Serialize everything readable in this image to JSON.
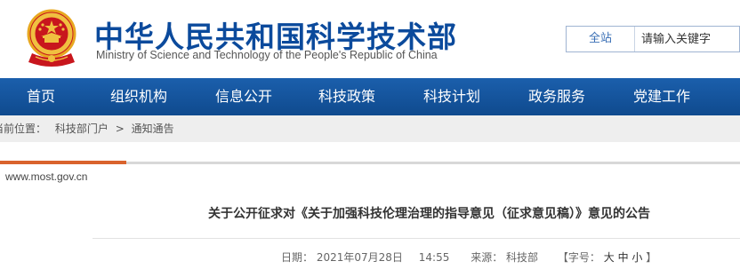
{
  "header": {
    "title_cn": "中华人民共和国科学技术部",
    "title_en": "Ministry of Science and Technology of the People's Republic of China",
    "emblem_icon": "national-emblem-icon",
    "search": {
      "scope": "全站",
      "placeholder": "请输入关键字"
    },
    "colors": {
      "brand": "#0b4a9c",
      "emblem_red": "#c8161d",
      "emblem_gold": "#f0c040"
    }
  },
  "nav": {
    "items": [
      {
        "label": "首页"
      },
      {
        "label": "组织机构"
      },
      {
        "label": "信息公开"
      },
      {
        "label": "科技政策"
      },
      {
        "label": "科技计划"
      },
      {
        "label": "政务服务"
      },
      {
        "label": "党建工作"
      }
    ],
    "colors": {
      "background": "#15559f",
      "text": "#ffffff"
    }
  },
  "breadcrumb": {
    "prefix": "当前位置：",
    "items": [
      "科技部门户",
      "通知通告"
    ],
    "separator": ">"
  },
  "content": {
    "site_url": "www.most.gov.cn",
    "article_title": "关于公开征求对《关于加强科技伦理治理的指导意见（征求意见稿）》意见的公告",
    "meta": {
      "date_label": "日期：",
      "date": "2021年07月28日",
      "time": "14:55",
      "source_label": "来源：",
      "source": "科技部",
      "font_label_open": "【字号：",
      "font_large": "大",
      "font_medium": "中",
      "font_small": "小",
      "font_label_close": "】"
    },
    "colors": {
      "accent": "#d9632d"
    }
  }
}
